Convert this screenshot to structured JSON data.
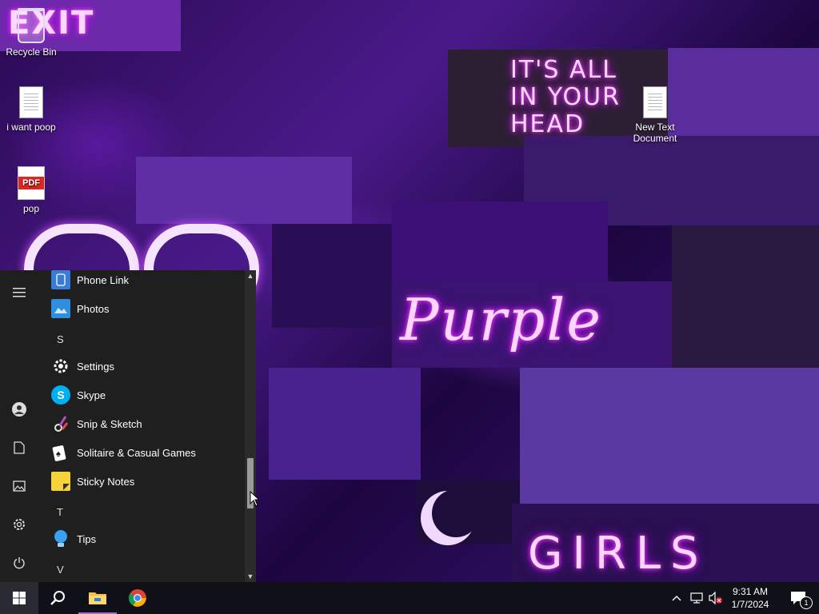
{
  "wallpaper": {
    "texts": {
      "exit": "EXIT",
      "head_line1": "IT'S ALL",
      "head_line2": "IN YOUR",
      "head_line3": "HEAD",
      "purple": "Purple",
      "girls": "GIRLS"
    }
  },
  "desktop": {
    "icons": [
      {
        "label": "Recycle Bin",
        "icon": "recycle-bin-icon"
      },
      {
        "label": "i want poop",
        "icon": "text-file-icon"
      },
      {
        "label": "pop",
        "icon": "pdf-file-icon",
        "badge": "PDF"
      },
      {
        "label": "New Text Document",
        "icon": "text-file-icon"
      }
    ]
  },
  "start_menu": {
    "rail": [
      "hamburger-icon",
      "user-icon",
      "documents-icon",
      "pictures-icon",
      "settings-icon",
      "power-icon"
    ],
    "apps": [
      {
        "label": "Phone Link",
        "icon": "phone-link-icon",
        "color": "#3a7bd5"
      },
      {
        "label": "Photos",
        "icon": "photos-icon",
        "color": "#2f8fde"
      },
      {
        "letter": "S"
      },
      {
        "label": "Settings",
        "icon": "gear-icon",
        "color": "#1f1f1f"
      },
      {
        "label": "Skype",
        "icon": "skype-icon",
        "color": "#00aff0",
        "glyph": "S"
      },
      {
        "label": "Snip & Sketch",
        "icon": "snip-sketch-icon",
        "color": "#b34fc2"
      },
      {
        "label": "Solitaire & Casual Games",
        "icon": "solitaire-icon",
        "color": "#ffffff"
      },
      {
        "label": "Sticky Notes",
        "icon": "sticky-notes-icon",
        "color": "#f7d33b"
      },
      {
        "letter": "T"
      },
      {
        "label": "Tips",
        "icon": "tips-icon",
        "color": "#3aa0f0"
      },
      {
        "letter": "V"
      }
    ]
  },
  "taskbar": {
    "pinned": [
      "windows-start-icon",
      "search-icon",
      "file-explorer-icon",
      "chrome-icon"
    ],
    "clock": {
      "time": "9:31 AM",
      "date": "1/7/2024"
    },
    "notifications_count": "1"
  }
}
